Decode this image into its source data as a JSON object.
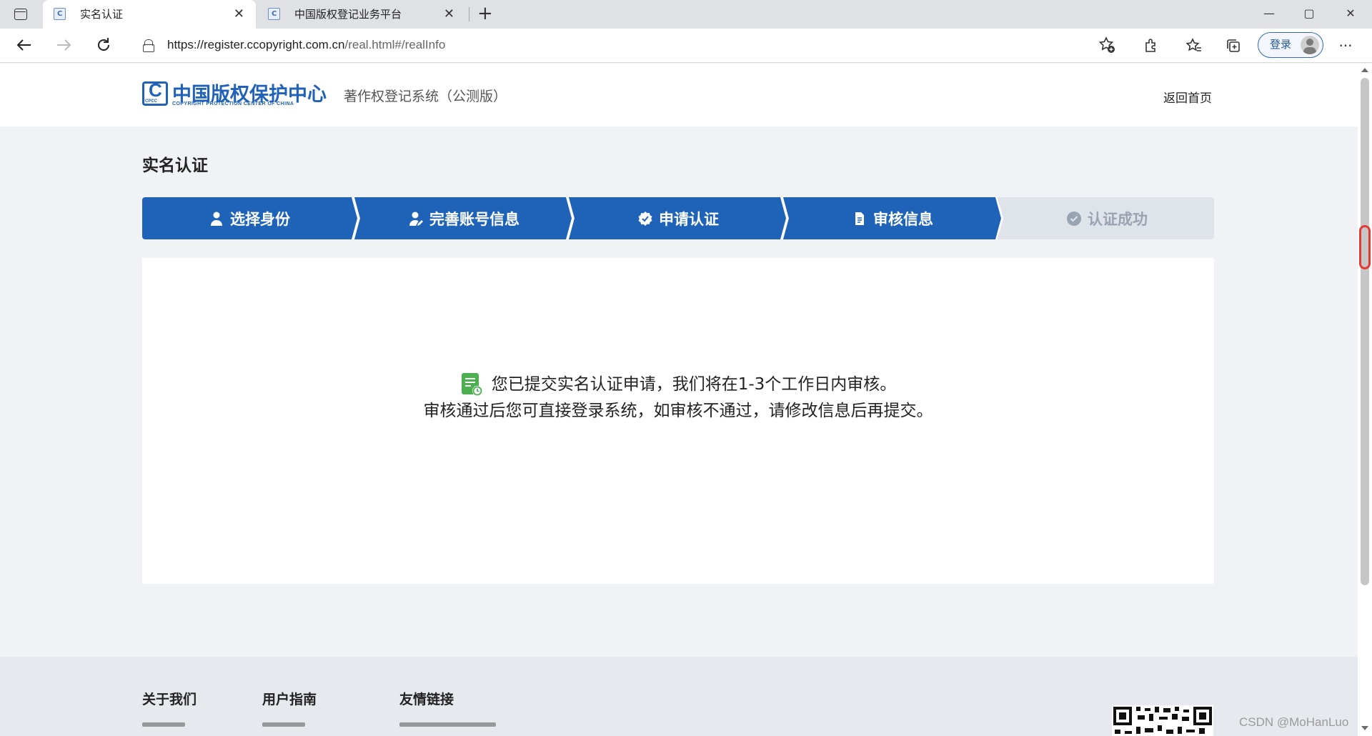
{
  "browser": {
    "tabs": [
      {
        "title": "实名认证",
        "active": true
      },
      {
        "title": "中国版权登记业务平台",
        "active": false
      }
    ],
    "url_host": "https://register.ccopyright.com.cn",
    "url_path": "/real.html#/realInfo",
    "login_label": "登录",
    "window_controls": {
      "minimize": "—",
      "maximize": "▢",
      "close": "✕"
    }
  },
  "header": {
    "logo_name": "中国版权保护中心",
    "logo_sub": "COPYRIGHT PROTECTION CENTER OF CHINA",
    "logo_mark": "CPCC",
    "system_name": "著作权登记系统（公测版）",
    "home_link": "返回首页"
  },
  "page_title": "实名认证",
  "steps": [
    {
      "label": "选择身份",
      "icon": "user-icon",
      "status": "done"
    },
    {
      "label": "完善账号信息",
      "icon": "user-edit-icon",
      "status": "done"
    },
    {
      "label": "申请认证",
      "icon": "badge-check-icon",
      "status": "done"
    },
    {
      "label": "审核信息",
      "icon": "document-icon",
      "status": "current"
    },
    {
      "label": "认证成功",
      "icon": "check-circle-icon",
      "status": "pending"
    }
  ],
  "message": {
    "line1": "您已提交实名认证申请，我们将在1-3个工作日内审核。",
    "line2": "审核通过后您可直接登录系统，如审核不通过，请修改信息后再提交。",
    "icon": "document-clock-icon"
  },
  "footer": {
    "headings": [
      "关于我们",
      "用户指南",
      "友情链接"
    ]
  },
  "watermark": "CSDN @MoHanLuo",
  "colors": {
    "primary": "#1f63b8",
    "pending_step": "#dfe3ea",
    "page_bg": "#f0f2f5",
    "success_icon": "#4caf50"
  }
}
